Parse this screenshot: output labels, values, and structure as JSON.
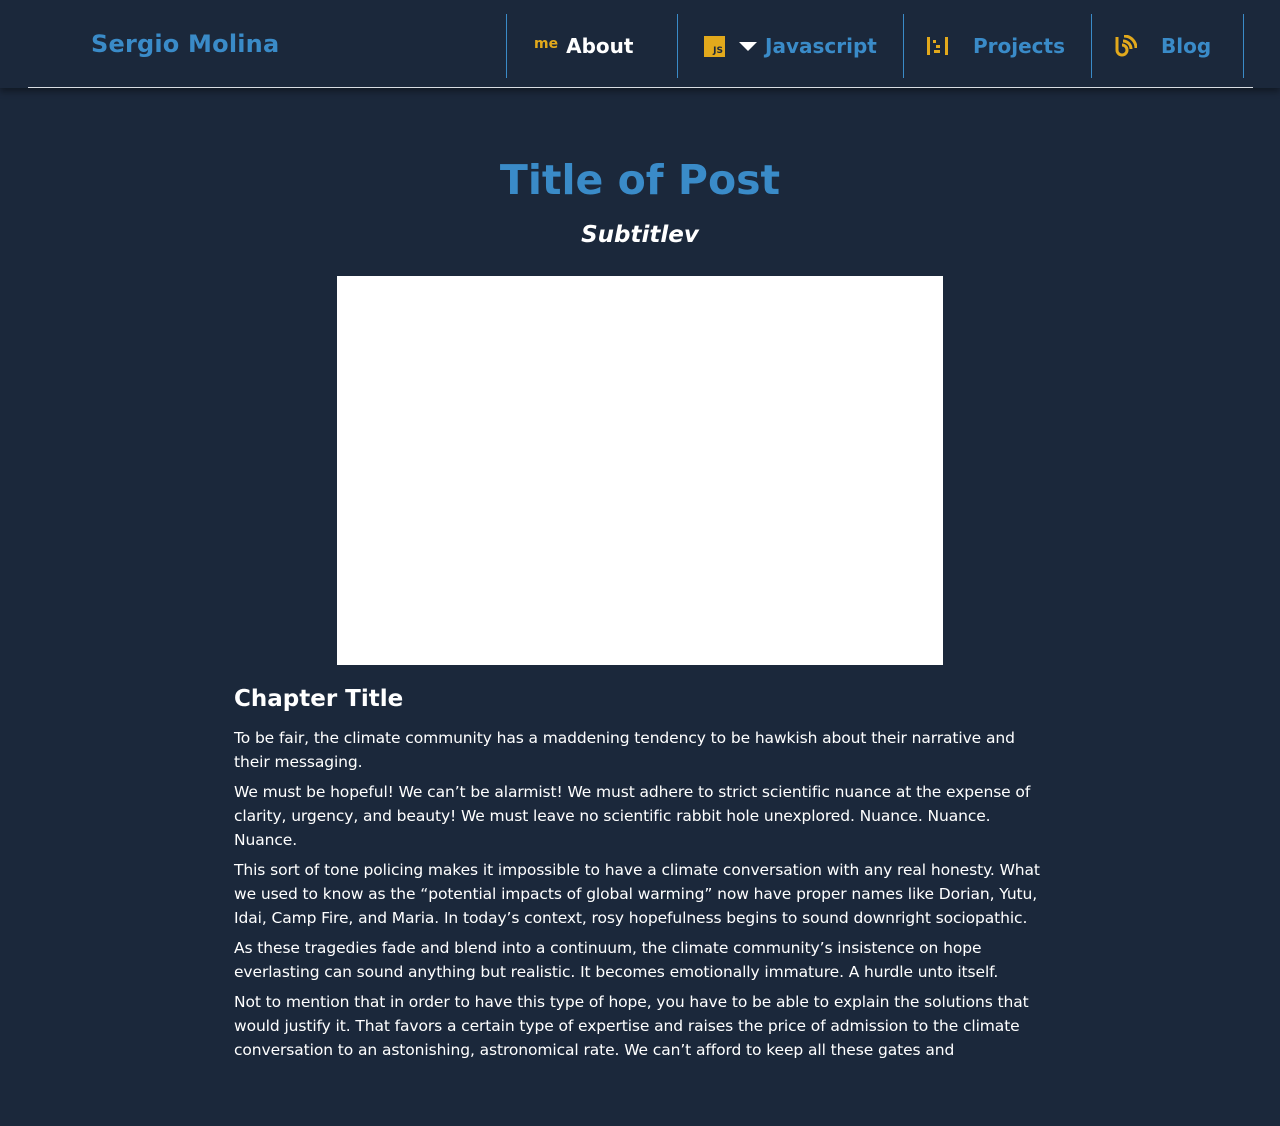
{
  "header": {
    "brand": "Sergio Molina",
    "nav": [
      {
        "label": "About",
        "icon": "me-icon",
        "icon_text": "me"
      },
      {
        "label": "Javascript",
        "icon": "js-icon",
        "icon_text": "JS"
      },
      {
        "label": "Projects",
        "icon": "projects-icon"
      },
      {
        "label": "Blog",
        "icon": "blog-icon"
      }
    ]
  },
  "colors": {
    "background": "#1b283b",
    "accent": "#3a8bc8",
    "icon": "#e2a91c",
    "text": "#ffffff"
  },
  "post": {
    "title": "Title of Post",
    "subtitle": "Subtitlev",
    "chapter_title": "Chapter Title",
    "paragraphs": [
      "To be fair, the climate community has a maddening tendency to be hawkish about their narrative and their messaging.",
      "We must be hopeful! We can’t be alarmist! We must adhere to strict scientific nuance at the expense of clarity, urgency, and beauty! We must leave no scientific rabbit hole unexplored. Nuance. Nuance. Nuance.",
      "This sort of tone policing makes it impossible to have a climate conversation with any real honesty. What we used to know as the “potential impacts of global warming” now have proper names like Dorian, Yutu, Idai, Camp Fire, and Maria. In today’s context, rosy hopefulness begins to sound downright sociopathic.",
      "As these tragedies fade and blend into a continuum, the climate community’s insistence on hope everlasting can sound anything but realistic. It becomes emotionally immature. A hurdle unto itself.",
      "Not to mention that in order to have this type of hope, you have to be able to explain the solutions that would justify it. That favors a certain type of expertise and raises the price of admission to the climate conversation to an astonishing, astronomical rate. We can’t afford to keep all these gates and"
    ]
  }
}
